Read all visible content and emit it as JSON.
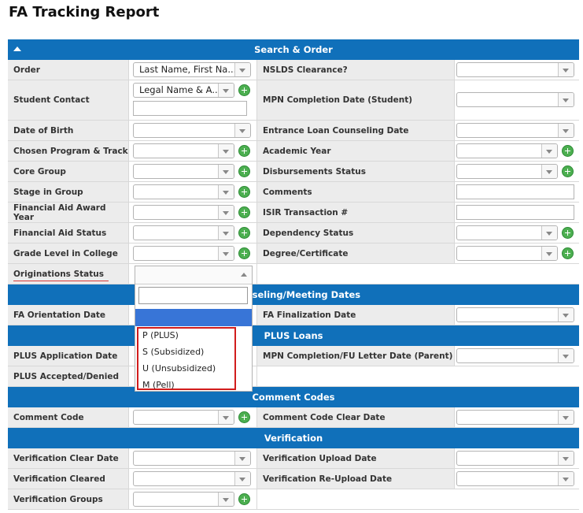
{
  "title": "FA Tracking Report",
  "sections": {
    "search": "Search & Order",
    "counseling": "Counseling/Meeting Dates",
    "plus": "PLUS Loans",
    "comment": "Comment Codes",
    "verification": "Verification"
  },
  "labels": {
    "order": "Order",
    "nslds": "NSLDS Clearance?",
    "student_contact": "Student Contact",
    "mpn_student": "MPN Completion Date (Student)",
    "dob": "Date of Birth",
    "entrance": "Entrance Loan Counseling Date",
    "program": "Chosen Program & Track",
    "academic_year": "Academic Year",
    "core_group": "Core Group",
    "disbursements": "Disbursements Status",
    "stage": "Stage in Group",
    "comments": "Comments",
    "award_year": "Financial Aid Award Year",
    "isir": "ISIR Transaction #",
    "fa_status": "Financial Aid Status",
    "dependency": "Dependency Status",
    "grade": "Grade Level in College",
    "degree": "Degree/Certificate",
    "originations": "Originations Status",
    "fa_orientation": "FA Orientation Date",
    "fa_finalization": "FA Finalization Date",
    "plus_app": "PLUS Application Date",
    "mpn_parent": "MPN Completion/FU Letter Date (Parent)",
    "plus_accepted": "PLUS Accepted/Denied",
    "comment_code": "Comment Code",
    "comment_clear": "Comment Code Clear Date",
    "ver_clear_date": "Verification Clear Date",
    "ver_upload": "Verification Upload Date",
    "ver_cleared": "Verification Cleared",
    "ver_reupload": "Verification Re-Upload Date",
    "ver_groups": "Verification Groups"
  },
  "values": {
    "order": "Last Name, First Na...",
    "student_contact": "Legal Name & A..."
  },
  "originations_dropdown": {
    "options": [
      "P (PLUS)",
      "S (Subsidized)",
      "U (Unsubsidized)",
      "M (Pell)"
    ]
  },
  "colors": {
    "header": "#1070ba",
    "label_bg": "#ececec",
    "highlight": "#3875d7",
    "callout": "#d11c1c"
  }
}
